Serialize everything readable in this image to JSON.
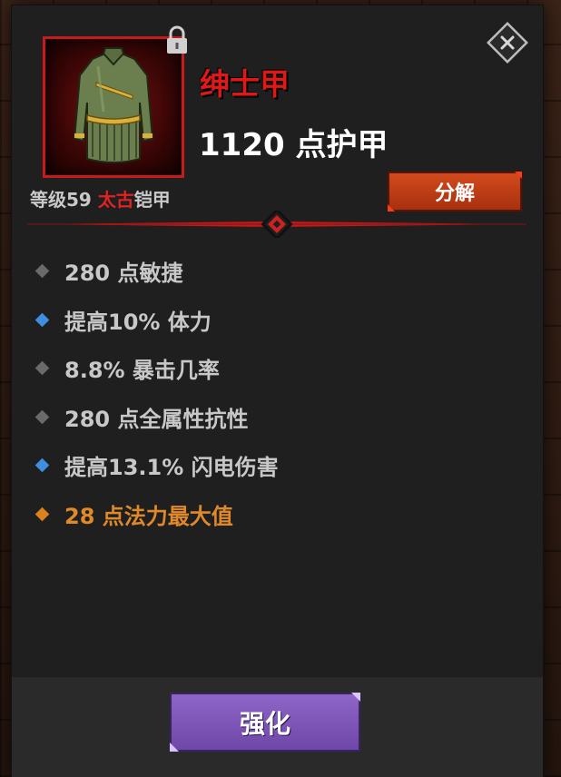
{
  "item": {
    "name": "绅士甲",
    "armor_value": "1120 点护甲",
    "level_label": "等级59",
    "rarity": "太古",
    "slot_type": "铠甲",
    "icon": "green-coat-armor-icon",
    "name_color": "#e01818",
    "rarity_color": "#e02222"
  },
  "buttons": {
    "salvage": "分解",
    "enhance": "强化",
    "close_icon": "close-icon",
    "lock_icon": "lock-icon"
  },
  "stats": [
    {
      "text": "280 点敏捷",
      "bullet": "gray"
    },
    {
      "text": "提高10% 体力",
      "bullet": "blue"
    },
    {
      "text": "8.8% 暴击几率",
      "bullet": "gray"
    },
    {
      "text": "280 点全属性抗性",
      "bullet": "gray"
    },
    {
      "text": "提高13.1% 闪电伤害",
      "bullet": "blue"
    },
    {
      "text": "28 点法力最大值",
      "bullet": "orange"
    }
  ],
  "colors": {
    "bullet_gray": "#6a6a6a",
    "bullet_blue": "#3e8fe0",
    "bullet_orange": "#d9821e",
    "salvage_button": "#c0401a",
    "enhance_button": "#7e56b8"
  }
}
